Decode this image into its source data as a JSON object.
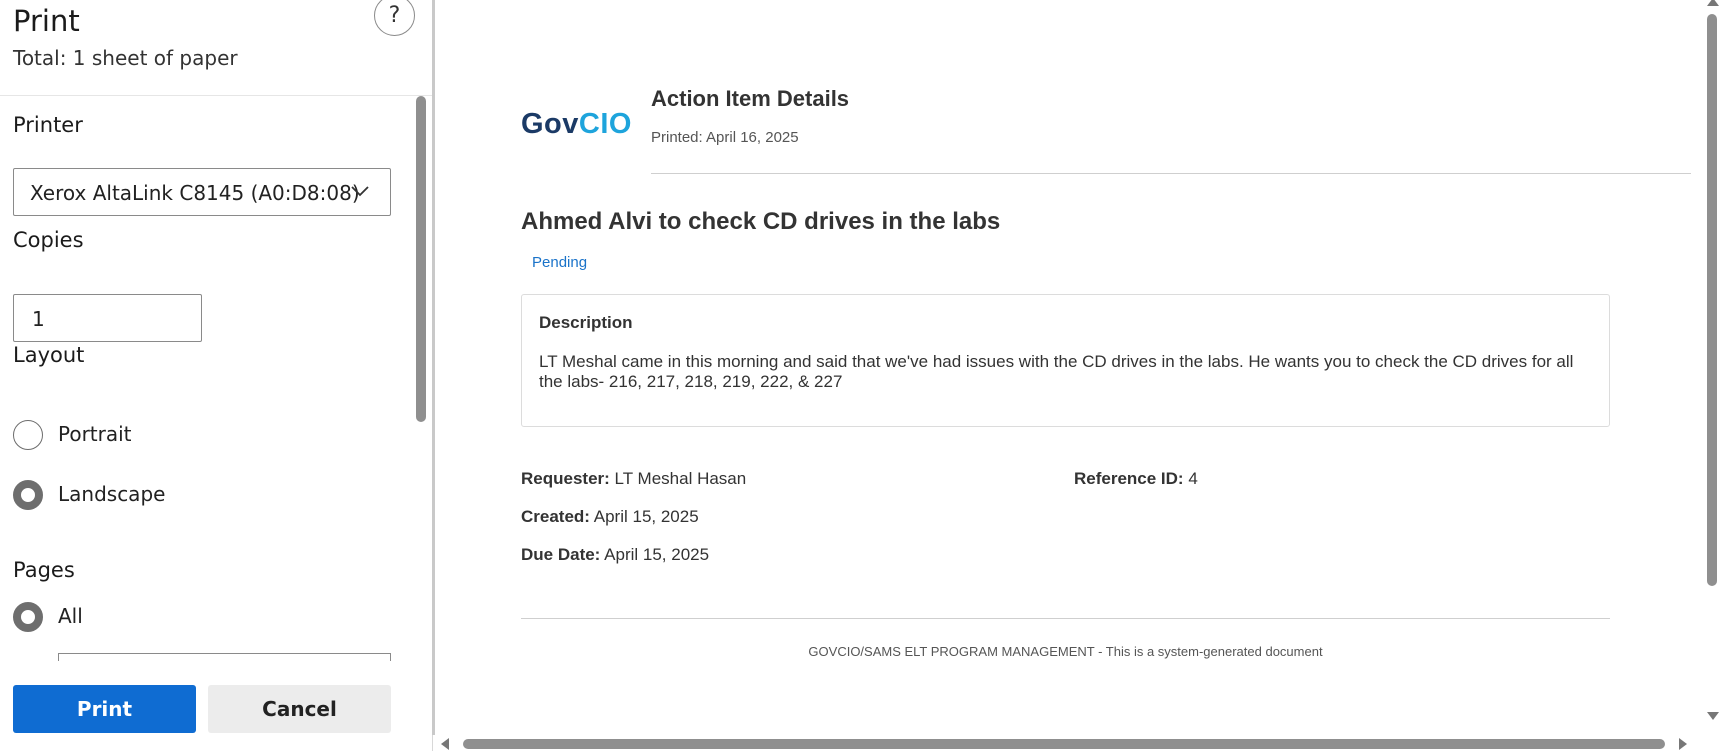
{
  "panel": {
    "title": "Print",
    "total": "Total: 1 sheet of paper",
    "help": "?",
    "printer_label": "Printer",
    "printer_value": "Xerox AltaLink C8145 (A0:D8:08)",
    "copies_label": "Copies",
    "copies_value": "1",
    "layout_label": "Layout",
    "layout_options": [
      "Portrait",
      "Landscape"
    ],
    "layout_selected": "Landscape",
    "pages_label": "Pages",
    "pages_options": [
      "All"
    ],
    "pages_selected": "All",
    "print_button": "Print",
    "cancel_button": "Cancel"
  },
  "document": {
    "logo_gov": "Gov",
    "logo_cio": "CIO",
    "title": "Action Item Details",
    "printed": "Printed: April 16, 2025",
    "item_title": "Ahmed Alvi to check CD drives in the labs",
    "status": "Pending",
    "description_heading": "Description",
    "description_text": "LT Meshal came in this morning and said that we've had issues with the CD drives in the labs. He wants you to check the CD drives for all the labs- 216, 217, 218, 219, 222, & 227",
    "requester_label": "Requester:",
    "requester_value": "LT Meshal Hasan",
    "reference_label": "Reference ID:",
    "reference_value": "4",
    "created_label": "Created:",
    "created_value": "April 15, 2025",
    "due_label": "Due Date:",
    "due_value": "April 15, 2025",
    "footer": "GOVCIO/SAMS ELT PROGRAM MANAGEMENT - This is a system-generated document"
  },
  "colors": {
    "print_button": "#0f6cd2",
    "logo_gov": "#1b3a66",
    "logo_cio": "#1ea4dc",
    "status": "#1a73c9"
  }
}
